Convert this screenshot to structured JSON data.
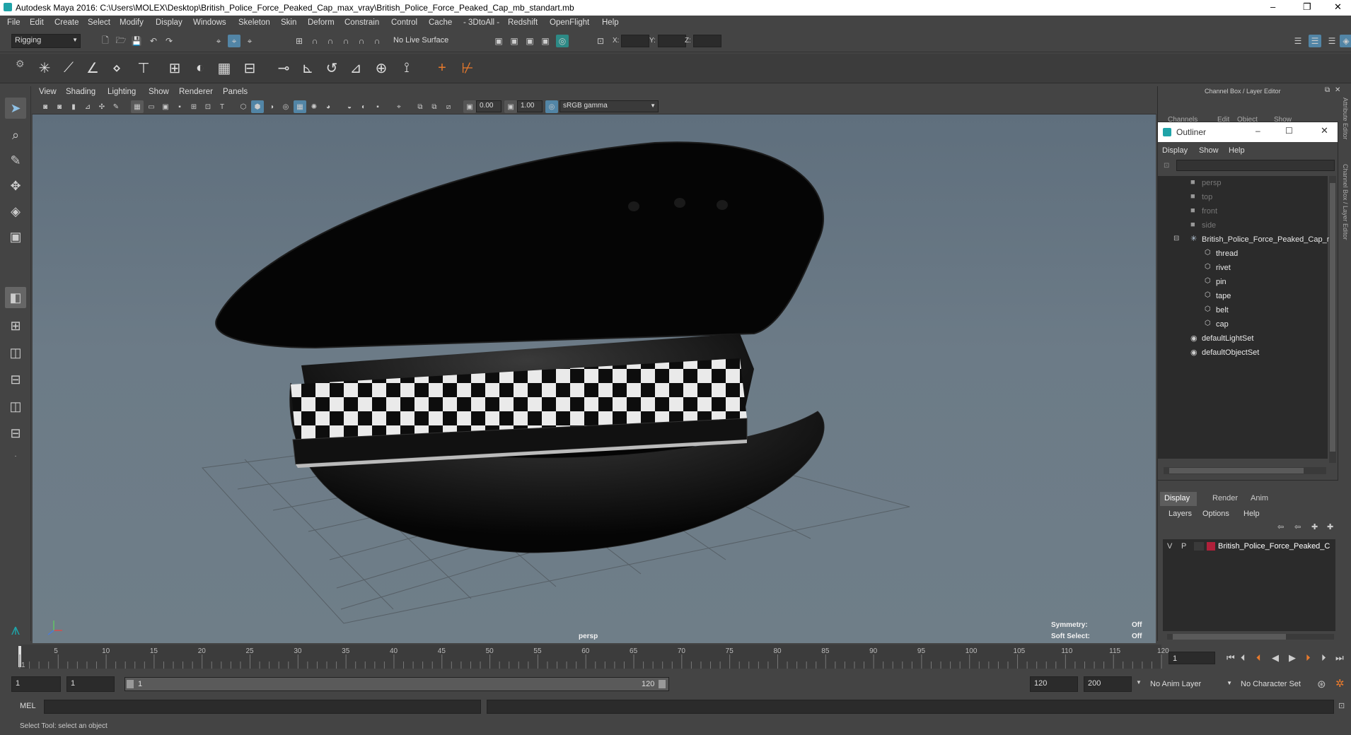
{
  "window": {
    "title": "Autodesk Maya 2016: C:\\Users\\MOLEX\\Desktop\\British_Police_Force_Peaked_Cap_max_vray\\British_Police_Force_Peaked_Cap_mb_standart.mb",
    "minimize": "–",
    "restore": "❐",
    "close": "✕"
  },
  "menubar": [
    "File",
    "Edit",
    "Create",
    "Select",
    "Modify",
    "Display",
    "Windows",
    "Skeleton",
    "Skin",
    "Deform",
    "Constrain",
    "Control",
    "Cache",
    "- 3DtoAll -",
    "Redshift",
    "OpenFlight",
    "Help"
  ],
  "statusline": {
    "mode": "Rigging",
    "live_surface": "No Live Surface",
    "x_label": "X:",
    "y_label": "Y:",
    "z_label": "Z:"
  },
  "viewport": {
    "menu": [
      "View",
      "Shading",
      "Lighting",
      "Show",
      "Renderer",
      "Panels"
    ],
    "exposure": "0.00",
    "gamma": "1.00",
    "colorspace": "sRGB gamma",
    "camera_label": "persp",
    "symmetry_label": "Symmetry:",
    "symmetry_value": "Off",
    "soft_select_label": "Soft Select:",
    "soft_select_value": "Off"
  },
  "channelbox": {
    "title": "Channel Box / Layer Editor",
    "tabs": [
      "Channels",
      "Edit",
      "Object",
      "Show"
    ],
    "side_tabs": [
      "Attribute Editor",
      "Channel Box / Layer Editor"
    ]
  },
  "outliner": {
    "title": "Outliner",
    "menu": [
      "Display",
      "Show",
      "Help"
    ],
    "items": [
      {
        "label": "persp",
        "dim": true,
        "depth": 0
      },
      {
        "label": "top",
        "dim": true,
        "depth": 0
      },
      {
        "label": "front",
        "dim": true,
        "depth": 0
      },
      {
        "label": "side",
        "dim": true,
        "depth": 0
      },
      {
        "label": "British_Police_Force_Peaked_Cap_r",
        "dim": false,
        "depth": 0
      },
      {
        "label": "thread",
        "dim": false,
        "depth": 1
      },
      {
        "label": "rivet",
        "dim": false,
        "depth": 1
      },
      {
        "label": "pin",
        "dim": false,
        "depth": 1
      },
      {
        "label": "tape",
        "dim": false,
        "depth": 1
      },
      {
        "label": "belt",
        "dim": false,
        "depth": 1
      },
      {
        "label": "cap",
        "dim": false,
        "depth": 1
      },
      {
        "label": "defaultLightSet",
        "dim": false,
        "depth": 0
      },
      {
        "label": "defaultObjectSet",
        "dim": false,
        "depth": 0
      }
    ]
  },
  "layers": {
    "tabs": [
      "Display",
      "Render",
      "Anim"
    ],
    "menu": [
      "Layers",
      "Options",
      "Help"
    ],
    "row": {
      "v": "V",
      "p": "P",
      "name": "British_Police_Force_Peaked_C",
      "color": "#b0203a"
    }
  },
  "timeline": {
    "ticks": [
      "1",
      "5",
      "10",
      "15",
      "20",
      "25",
      "30",
      "35",
      "40",
      "45",
      "50",
      "55",
      "60",
      "65",
      "70",
      "75",
      "80",
      "85",
      "90",
      "95",
      "100",
      "105",
      "110",
      "115",
      "120"
    ],
    "current_frame": "1"
  },
  "range": {
    "start": "1",
    "playback_start": "1",
    "slider_start": "1",
    "slider_end": "120",
    "playback_end": "120",
    "end": "200",
    "anim_layer": "No Anim Layer",
    "character_set": "No Character Set"
  },
  "cmd": {
    "label": "MEL"
  },
  "help_line": "Select Tool: select an object"
}
